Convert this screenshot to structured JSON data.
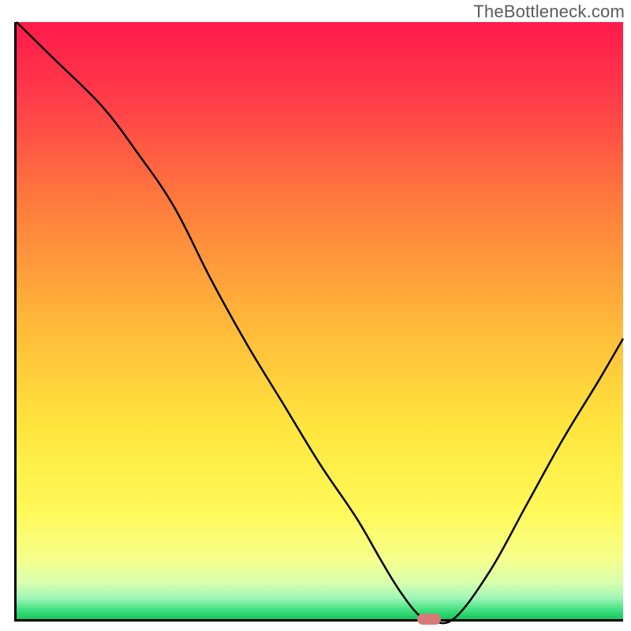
{
  "watermark": "TheBottleneck.com",
  "chart_data": {
    "type": "line",
    "title": "",
    "xlabel": "",
    "ylabel": "",
    "xlim": [
      0,
      100
    ],
    "ylim": [
      0,
      100
    ],
    "grid": false,
    "legend": false,
    "series": [
      {
        "name": "bottleneck-curve",
        "x": [
          0,
          6,
          14,
          20,
          26,
          32,
          38,
          44,
          50,
          56,
          60,
          63,
          66,
          68,
          72,
          78,
          84,
          90,
          96,
          100
        ],
        "y": [
          100,
          94,
          86,
          78,
          69,
          57,
          46,
          36,
          26,
          17,
          10,
          5,
          1,
          0,
          0,
          8,
          19,
          30,
          40,
          47
        ]
      }
    ],
    "marker": {
      "name": "optimal-point",
      "x": 68,
      "y": 0
    },
    "background_gradient": {
      "stops": [
        {
          "at": 0.0,
          "color": "#ff1a4b"
        },
        {
          "at": 0.12,
          "color": "#ff3a4a"
        },
        {
          "at": 0.3,
          "color": "#ff7a3d"
        },
        {
          "at": 0.5,
          "color": "#ffb73a"
        },
        {
          "at": 0.68,
          "color": "#ffe63e"
        },
        {
          "at": 0.82,
          "color": "#fff95a"
        },
        {
          "at": 0.9,
          "color": "#f6ff8c"
        },
        {
          "at": 0.94,
          "color": "#d7ffae"
        },
        {
          "at": 0.965,
          "color": "#9ef5b8"
        },
        {
          "at": 0.985,
          "color": "#3fe07e"
        },
        {
          "at": 1.0,
          "color": "#17c45c"
        }
      ]
    }
  }
}
